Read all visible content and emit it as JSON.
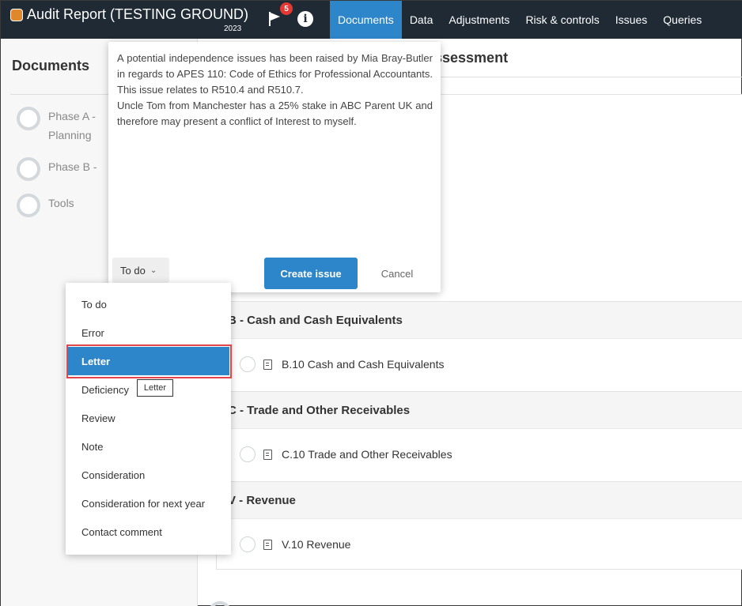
{
  "app": {
    "title": "Audit Report (TESTING GROUND)",
    "year": "2023",
    "flag_count": "5",
    "info_glyph": "i"
  },
  "nav": {
    "tabs": [
      {
        "label": "Documents",
        "active": true
      },
      {
        "label": "Data"
      },
      {
        "label": "Adjustments"
      },
      {
        "label": "Risk & controls"
      },
      {
        "label": "Issues"
      },
      {
        "label": "Queries"
      }
    ]
  },
  "sidebar": {
    "title": "Documents",
    "items": [
      {
        "label": "Phase A - Planning Assessment"
      },
      {
        "label": "Phase B - Risk"
      },
      {
        "label": "Tools"
      }
    ]
  },
  "main": {
    "title": "ssessment",
    "sections": [
      {
        "header": "B - Cash and Cash Equivalents",
        "row": "B.10 Cash and Cash Equivalents"
      },
      {
        "header": "C - Trade and Other Receivables",
        "row": "C.10 Trade and Other Receivables"
      },
      {
        "header": "V - Revenue",
        "row": "V.10 Revenue"
      }
    ]
  },
  "issue_popup": {
    "text_line1": "A potential independence issues has been raised by Mia Bray-Butler in regards to APES 110: Code of Ethics for Professional Accountants. This issue relates to R510.4 and R510.7.",
    "text_line2": "Uncle Tom from Manchester has a 25% stake in ABC Parent UK and therefore may present a conflict of Interest to myself.",
    "status_value": "To do",
    "create_label": "Create issue",
    "cancel_label": "Cancel"
  },
  "status_menu": {
    "options": [
      "To do",
      "Error",
      "Letter",
      "Deficiency",
      "Review",
      "Note",
      "Consideration",
      "Consideration for next year",
      "Contact comment"
    ],
    "selected": "Letter",
    "tooltip": "Letter"
  },
  "colors": {
    "topbar": "#1f2a35",
    "accent": "#2d86c9",
    "badge": "#e53935",
    "highlight": "#e0474c"
  }
}
